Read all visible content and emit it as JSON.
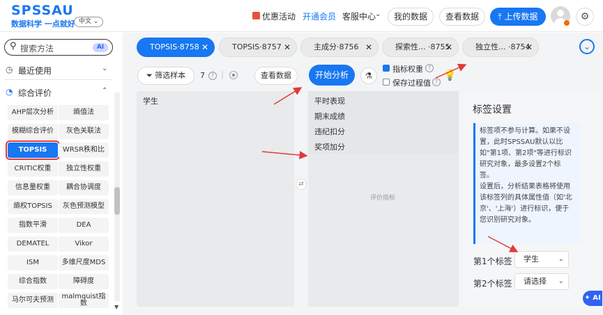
{
  "brand": {
    "title": "SPSSAU",
    "slogan": "数据科学 一点就好",
    "lang": "中文 ⌄"
  },
  "header": {
    "promo": "优惠活动",
    "vip": "开通会员",
    "service": "客服中心",
    "my_data": "我的数据",
    "view_data": "查看数据",
    "upload": "上传数据"
  },
  "sidebar": {
    "search_placeholder": "搜索方法",
    "ai_badge": "AI",
    "recent": "最近使用",
    "group": "综合评价",
    "items": [
      [
        "AHP层次分析",
        "熵值法"
      ],
      [
        "模糊综合评价",
        "灰色关联法"
      ],
      [
        "TOPSIS",
        "WRSR秩和比"
      ],
      [
        "CRITIC权重",
        "独立性权重"
      ],
      [
        "信息量权重",
        "耦合协调度"
      ],
      [
        "熵权TOPSIS",
        "灰色预测模型"
      ],
      [
        "指数平滑",
        "DEA"
      ],
      [
        "DEMATEL",
        "Vikor"
      ],
      [
        "ISM",
        "多维尺度MDS"
      ],
      [
        "综合指数",
        "障碍度"
      ],
      [
        "马尔可夫预测",
        "malmquist指数"
      ]
    ]
  },
  "tabs": [
    {
      "label": "TOPSIS·8758",
      "active": true
    },
    {
      "label": "TOPSIS·8757",
      "active": false
    },
    {
      "label": "主成分·8756",
      "active": false
    },
    {
      "label": "探索性...   ·8755",
      "active": false
    },
    {
      "label": "独立性...   ·8754",
      "active": false
    }
  ],
  "toolbar": {
    "filter": "筛选样本",
    "count": "7",
    "view_data": "查看数据",
    "run": "开始分析",
    "weight": "指标权重",
    "save": "保存过程值"
  },
  "variables": {
    "left": [
      "学生"
    ],
    "right": [
      "平时表现",
      "期末成绩",
      "违纪扣分",
      "奖项加分"
    ],
    "right_placeholder": "评价指标"
  },
  "label_settings": {
    "title": "标签设置",
    "tip": [
      "标签项不参与计算。如果不设",
      "置，此时SPSSAU默认以比",
      "如\"第1项、第2项\"等进行标识",
      "研究对象，最多设置2个标",
      "签。",
      "设置后，分析结果表格将使用",
      "该标签列的具体属性值（如'北",
      "京'、'上海'）进行标识，便于",
      "您识别研究对象。"
    ],
    "label1": "第1个标签",
    "value1": "学生",
    "label2": "第2个标签",
    "value2": "请选择"
  },
  "ai_float": "AI",
  "colors": {
    "accent": "#1877f2",
    "arrow": "#e23a3a"
  }
}
